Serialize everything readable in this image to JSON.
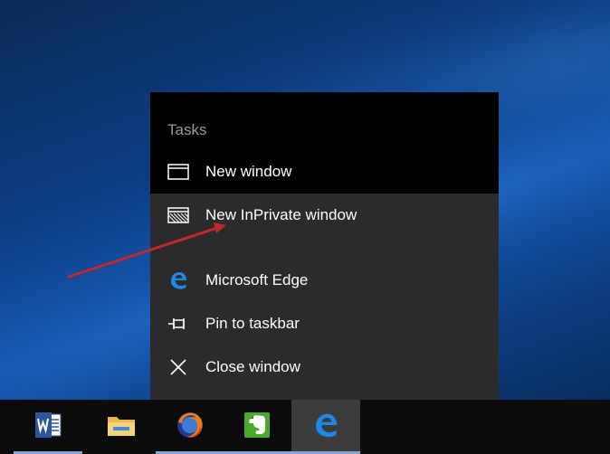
{
  "jumplist": {
    "header": "Tasks",
    "tasks": [
      {
        "label": "New window",
        "icon": "window-icon"
      },
      {
        "label": "New InPrivate window",
        "icon": "inprivate-window-icon"
      }
    ],
    "pinned": [
      {
        "label": "Microsoft Edge",
        "icon": "edge-icon"
      },
      {
        "label": "Pin to taskbar",
        "icon": "pin-icon"
      },
      {
        "label": "Close window",
        "icon": "close-icon"
      }
    ]
  },
  "taskbar": {
    "apps": [
      {
        "name": "Microsoft Word",
        "icon": "word-icon"
      },
      {
        "name": "File Explorer",
        "icon": "folder-icon"
      },
      {
        "name": "Firefox",
        "icon": "firefox-icon"
      },
      {
        "name": "Evernote",
        "icon": "evernote-icon"
      },
      {
        "name": "Microsoft Edge",
        "icon": "edge-icon",
        "active": true
      }
    ]
  },
  "colors": {
    "tasks_bg": "#000000",
    "menu_bg": "#2b2b2b",
    "taskbar_bg": "#0c0c0c",
    "active_app_bg": "#3c3c3c",
    "edge_blue": "#1e88e5",
    "annotation_arrow": "#c0282d"
  }
}
